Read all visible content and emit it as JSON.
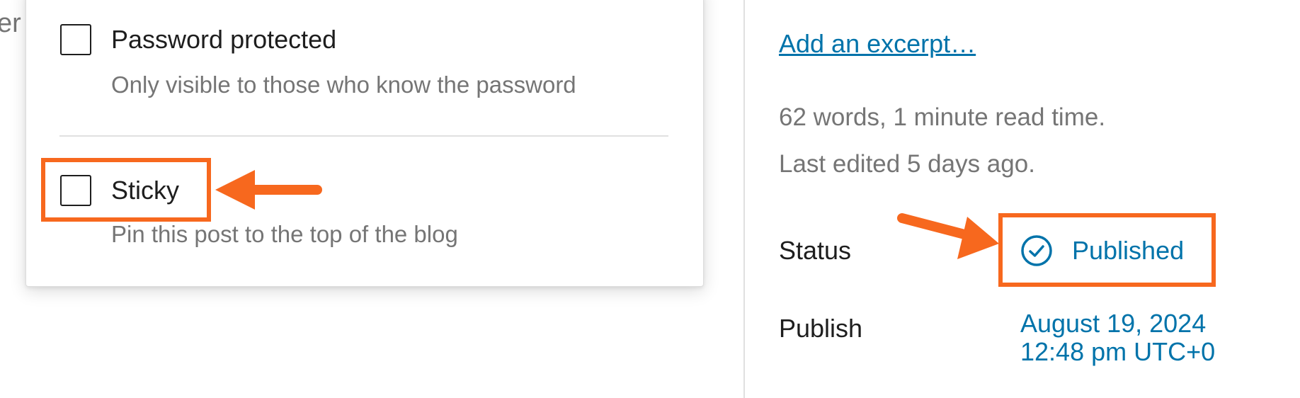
{
  "background": {
    "fragment": "er"
  },
  "visibility_popover": {
    "options": [
      {
        "label": "Password protected",
        "help": "Only visible to those who know the password",
        "checked": false
      },
      {
        "label": "Sticky",
        "help": "Pin this post to the top of the blog",
        "checked": false
      }
    ]
  },
  "sidebar": {
    "excerpt_link": "Add an excerpt…",
    "word_count": "62 words, 1 minute read time.",
    "last_edited": "Last edited 5 days ago.",
    "status": {
      "label": "Status",
      "value": "Published"
    },
    "publish": {
      "label": "Publish",
      "date": "August 19, 2024",
      "time": "12:48 pm UTC+0"
    }
  },
  "colors": {
    "accent": "#0073aa",
    "annotation": "#f7681e",
    "help_text": "#757575"
  },
  "icons": {
    "status": "published-check-circle-icon",
    "arrows": [
      "arrow-left-icon",
      "arrow-right-icon"
    ]
  }
}
